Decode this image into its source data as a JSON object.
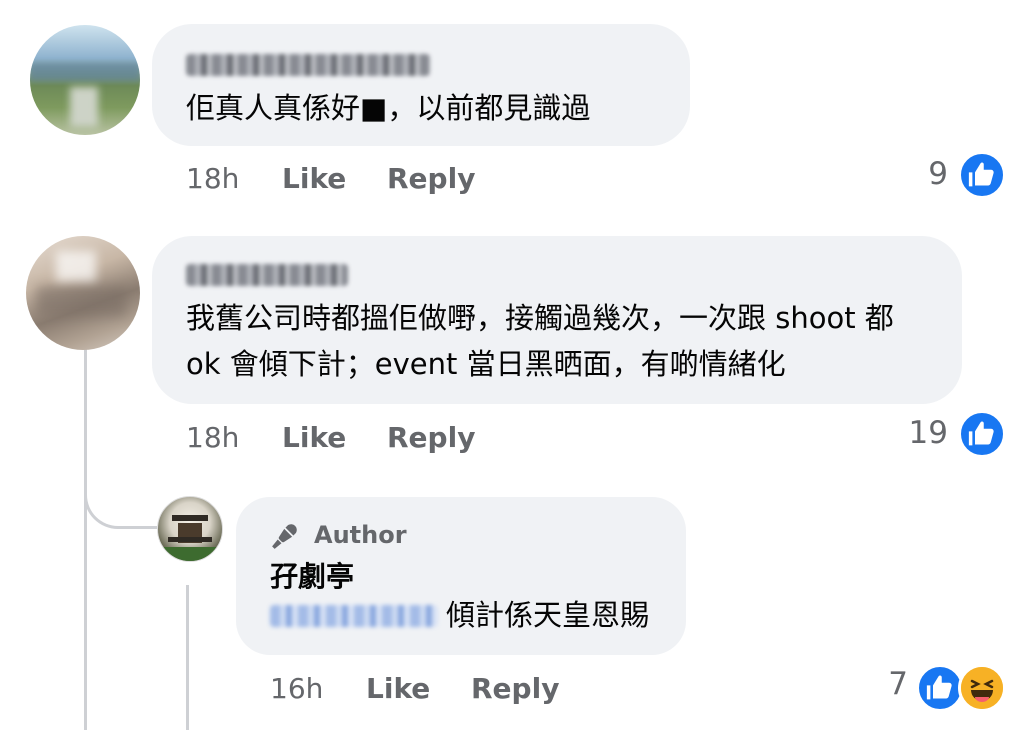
{
  "comments": [
    {
      "text": "佢真人真係好■，以前都見識過",
      "time": "18h",
      "like_label": "Like",
      "reply_label": "Reply",
      "reaction_count": "9"
    },
    {
      "text_line1": "我舊公司時都搵佢做嘢，接觸過幾次，一次跟 shoot 都",
      "text_line2": "ok 會傾下計；event 當日黑晒面，有啲情緒化",
      "time": "18h",
      "like_label": "Like",
      "reply_label": "Reply",
      "reaction_count": "19"
    }
  ],
  "reply": {
    "author_badge": "Author",
    "name": "孖劇亭",
    "text": "傾計係天皇恩賜",
    "time": "16h",
    "like_label": "Like",
    "reply_label": "Reply",
    "reaction_count": "7"
  },
  "colors": {
    "bubble": "#f0f2f5",
    "like_blue": "#1877f2",
    "meta_gray": "#65676b",
    "haha_yellow": "#f7b125"
  },
  "icons": [
    "thumbs-up-icon",
    "haha-emoji-icon",
    "microphone-icon"
  ]
}
